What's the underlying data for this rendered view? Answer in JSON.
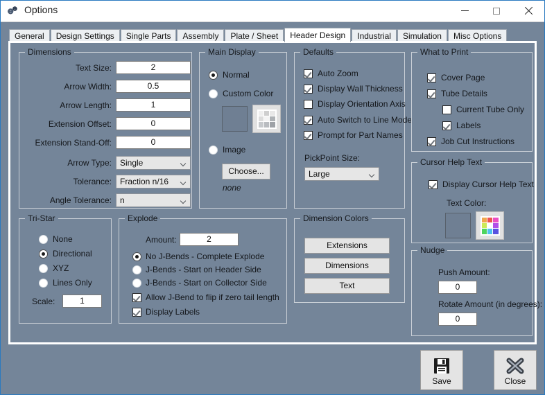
{
  "window": {
    "title": "Options",
    "icon": "gears-icon",
    "caption_buttons": [
      {
        "name": "minimize",
        "glyph": "minimize-icon"
      },
      {
        "name": "maximize",
        "glyph": "maximize-icon"
      },
      {
        "name": "close",
        "glyph": "close-icon"
      }
    ]
  },
  "tabs": [
    {
      "label": "General",
      "selected": false
    },
    {
      "label": "Design Settings",
      "selected": false
    },
    {
      "label": "Single Parts",
      "selected": false
    },
    {
      "label": "Assembly",
      "selected": false
    },
    {
      "label": "Plate / Sheet",
      "selected": false
    },
    {
      "label": "Header Design",
      "selected": true
    },
    {
      "label": "Industrial",
      "selected": false
    },
    {
      "label": "Simulation",
      "selected": false
    },
    {
      "label": "Misc Options",
      "selected": false
    }
  ],
  "dimensions": {
    "title": "Dimensions",
    "fields": [
      {
        "label": "Text Size:",
        "value": "2"
      },
      {
        "label": "Arrow Width:",
        "value": "0.5"
      },
      {
        "label": "Arrow Length:",
        "value": "1"
      },
      {
        "label": "Extension Offset:",
        "value": "0"
      },
      {
        "label": "Extension Stand-Off:",
        "value": "0"
      }
    ],
    "combos": [
      {
        "label": "Arrow Type:",
        "value": "Single"
      },
      {
        "label": "Tolerance:",
        "value": "Fraction n/16"
      },
      {
        "label": "Angle Tolerance:",
        "value": "n"
      }
    ]
  },
  "main_display": {
    "title": "Main Display",
    "options": [
      {
        "label": "Normal",
        "selected": true
      },
      {
        "label": "Custom Color",
        "selected": false
      },
      {
        "label": "Image",
        "selected": false
      }
    ],
    "choose_label": "Choose...",
    "image_value": "none",
    "palette_colors": [
      "#efefef",
      "#cfcfcf",
      "#e8e8e8",
      "#dcdcdc",
      "#f4f4f4",
      "#aeb2b6",
      "#c6c9cc",
      "#b9bcc0",
      "#9ea2a7"
    ]
  },
  "defaults": {
    "title": "Defaults",
    "checkboxes": [
      {
        "label": "Auto Zoom",
        "checked": true
      },
      {
        "label": "Display Wall Thickness",
        "checked": true
      },
      {
        "label": "Display Orientation Axis",
        "checked": false
      },
      {
        "label": "Auto Switch to Line Mode",
        "checked": true
      },
      {
        "label": "Prompt for Part Names",
        "checked": true
      }
    ],
    "pickpoint_label": "PickPoint Size:",
    "pickpoint_value": "Large"
  },
  "what_to_print": {
    "title": "What to Print",
    "checkboxes": [
      {
        "label": "Cover Page",
        "checked": true,
        "indent": false
      },
      {
        "label": "Tube Details",
        "checked": true,
        "indent": false
      },
      {
        "label": "Current Tube Only",
        "checked": false,
        "indent": true
      },
      {
        "label": "Labels",
        "checked": true,
        "indent": true
      },
      {
        "label": "Job Cut Instructions",
        "checked": true,
        "indent": false
      }
    ]
  },
  "cursor_help_text": {
    "title": "Cursor Help Text",
    "checkbox": {
      "label": "Display Cursor Help Text",
      "checked": true
    },
    "color_label": "Text Color:",
    "palette_colors": [
      "#f0a84e",
      "#ef5350",
      "#ec4fc4",
      "#cdea5a",
      "#ffffff",
      "#b24fe8",
      "#4fd45e",
      "#4fc3f0",
      "#5a53e0"
    ]
  },
  "nudge": {
    "title": "Nudge",
    "push_label": "Push Amount:",
    "push_value": "0",
    "rotate_label": "Rotate Amount (in degrees):",
    "rotate_value": "0"
  },
  "tri_star": {
    "title": "Tri-Star",
    "options": [
      {
        "label": "None",
        "selected": false
      },
      {
        "label": "Directional",
        "selected": true
      },
      {
        "label": "XYZ",
        "selected": false
      },
      {
        "label": "Lines Only",
        "selected": false
      }
    ],
    "scale_label": "Scale:",
    "scale_value": "1"
  },
  "explode": {
    "title": "Explode",
    "amount_label": "Amount:",
    "amount_value": "2",
    "options": [
      {
        "label": "No J-Bends  -  Complete Explode",
        "selected": true
      },
      {
        "label": "J-Bends  -  Start on Header Side",
        "selected": false
      },
      {
        "label": "J-Bends  -  Start on Collector Side",
        "selected": false
      }
    ],
    "checkboxes": [
      {
        "label": "Allow J-Bend to flip if zero tail length",
        "checked": true
      },
      {
        "label": "Display Labels",
        "checked": true
      }
    ]
  },
  "dimension_colors": {
    "title": "Dimension Colors",
    "buttons": [
      {
        "label": "Extensions"
      },
      {
        "label": "Dimensions"
      },
      {
        "label": "Text"
      }
    ]
  },
  "footer": {
    "save_label": "Save",
    "save_icon": "floppy-disk-icon",
    "close_label": "Close",
    "close_icon": "x-mark-icon"
  },
  "colors": {
    "window_background": "#748599",
    "panel_border": "#ffffff",
    "accent_border": "#2a7ac0",
    "titlebar": "#ffffff",
    "groupbox_border": "#c9cfd6",
    "button_face": "#e4e4e4"
  }
}
